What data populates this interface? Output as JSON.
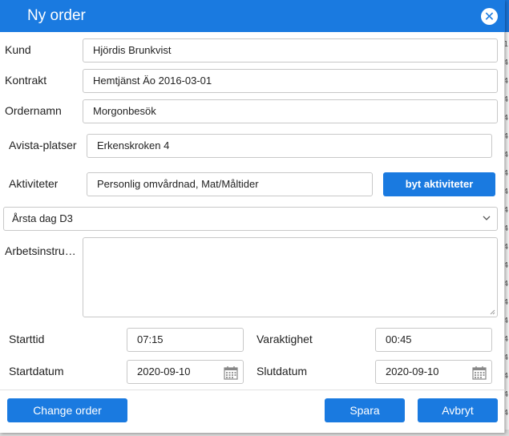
{
  "dialog": {
    "title": "Ny order",
    "close_label": "✕"
  },
  "form": {
    "kund": {
      "label": "Kund",
      "value": "Hjördis Brunkvist"
    },
    "kontrakt": {
      "label": "Kontrakt",
      "value": "Hemtjänst Äo 2016-03-01"
    },
    "ordernamn": {
      "label": "Ordernamn",
      "value": "Morgonbesök"
    },
    "avista": {
      "label": "Avista-platser",
      "value": "Erkenskroken 4"
    },
    "aktiviteter": {
      "label": "Aktiviteter",
      "value": "Personlig omvårdnad, Mat/Måltider",
      "button_label": "byt aktiviteter"
    },
    "group_select": {
      "value": "Årsta dag D3"
    },
    "arbetsinstruktion": {
      "label": "Arbetsinstruktion",
      "value": ""
    },
    "starttid": {
      "label": "Starttid",
      "value": "07:15"
    },
    "varaktighet": {
      "label": "Varaktighet",
      "value": "00:45"
    },
    "startdatum": {
      "label": "Startdatum",
      "value": "2020-09-10"
    },
    "slutdatum": {
      "label": "Slutdatum",
      "value": "2020-09-10"
    }
  },
  "footer": {
    "change_order_label": "Change order",
    "save_label": "Spara",
    "cancel_label": "Avbryt"
  },
  "colors": {
    "accent": "#1a7ae0",
    "background_header": "#1a73d6"
  },
  "background": {
    "right_column_glyphs": [
      "1",
      "4",
      "4",
      "4",
      "4",
      "4",
      "4",
      "4",
      "4",
      "4",
      "4",
      "4",
      "4",
      "4",
      "4",
      "4",
      "4",
      "4",
      "4",
      "4",
      "4"
    ]
  }
}
